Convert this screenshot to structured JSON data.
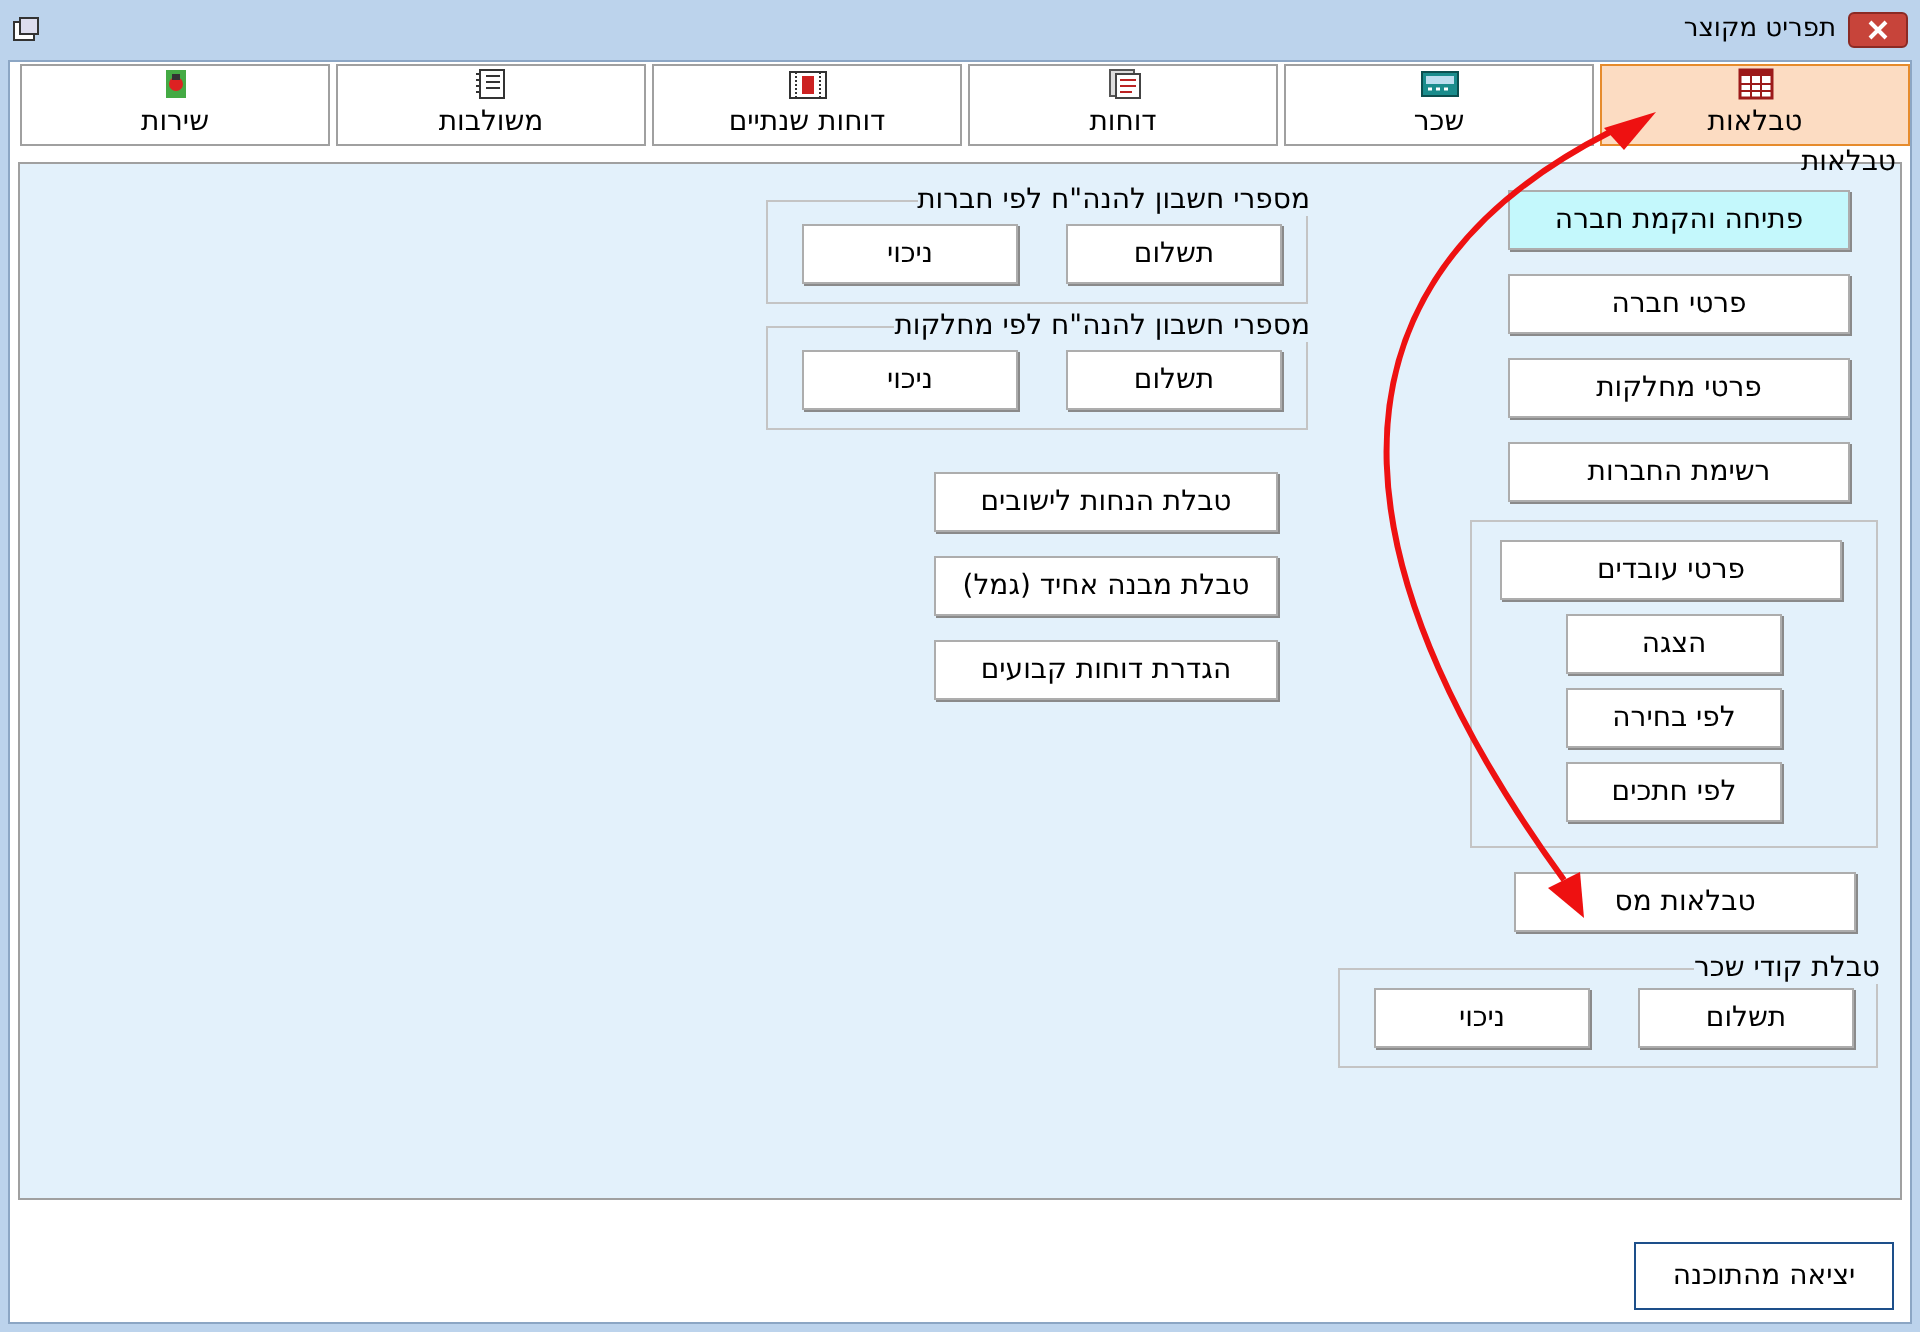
{
  "window": {
    "title": "תפריט מקוצר"
  },
  "tabs": [
    {
      "label": "טבלאות",
      "selected": true
    },
    {
      "label": "שכר",
      "selected": false
    },
    {
      "label": "דוחות",
      "selected": false
    },
    {
      "label": "דוחות שנתיים",
      "selected": false
    },
    {
      "label": "משולבות",
      "selected": false
    },
    {
      "label": "שירות",
      "selected": false
    }
  ],
  "section": {
    "title": "טבלאות"
  },
  "main_buttons": [
    {
      "label": "פתיחה והקמת חברה",
      "highlighted": true
    },
    {
      "label": "פרטי חברה",
      "highlighted": false
    },
    {
      "label": "פרטי מחלקות",
      "highlighted": false
    },
    {
      "label": "רשימת החברות",
      "highlighted": false
    }
  ],
  "employee_group": {
    "button": "פרטי עובדים",
    "sub_buttons": [
      "הצגה",
      "לפי בחירה",
      "לפי חתכים"
    ]
  },
  "tax_tables_button": "טבלאות מס",
  "wage_codes_group": {
    "title": "טבלת קודי שכר",
    "buttons": [
      "תשלום",
      "ניכוי"
    ]
  },
  "account_groups": [
    {
      "title": "מספרי חשבון להנה\"ח לפי חברות",
      "buttons": [
        "תשלום",
        "ניכוי"
      ]
    },
    {
      "title": "מספרי חשבון להנה\"ח לפי מחלקות",
      "buttons": [
        "תשלום",
        "ניכוי"
      ]
    }
  ],
  "report_buttons": [
    "טבלת הנחות לישובים",
    "טבלת מבנה אחיד (גמל)",
    "הגדרת דוחות קבועים"
  ],
  "exit_button": "יציאה מהתוכנה"
}
